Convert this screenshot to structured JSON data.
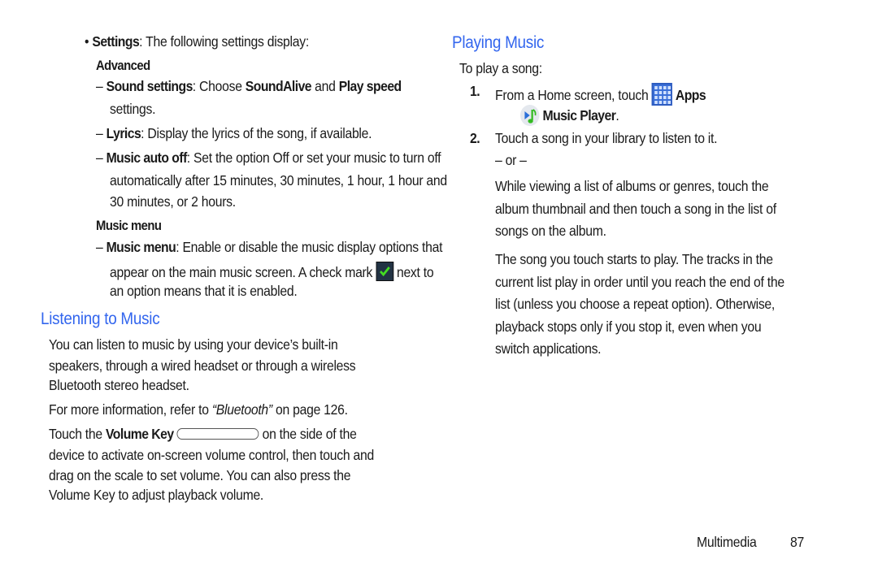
{
  "left": {
    "settings_bullet": {
      "bullet": "•",
      "label": "Settings",
      "text": ": The following settings display:"
    },
    "advanced_heading": "Advanced",
    "sound_settings": {
      "dash": "–",
      "label": "Sound settings",
      "text1": ": Choose ",
      "bold1": "SoundAlive",
      "text2": " and ",
      "bold2": "Play speed",
      "line2": "settings."
    },
    "lyrics": {
      "dash": "–",
      "label": "Lyrics",
      "text": ": Display the lyrics of the song, if available."
    },
    "music_auto_off": {
      "dash": "–",
      "label": "Music auto off",
      "text": ": Set the option Off or set your music to turn off",
      "line2": "automatically after 15 minutes, 30 minutes, 1 hour, 1 hour and",
      "line3": "30 minutes, or 2 hours."
    },
    "music_menu_heading": "Music menu",
    "music_menu": {
      "dash": "–",
      "label": "Music menu",
      "text": ": Enable or disable the music display options that",
      "line2a": "appear on the main music screen. A check mark",
      "line2b": "next to",
      "line3": "an option means that it is enabled."
    },
    "listening_heading": "Listening to Music",
    "listening_para": [
      "You can listen to music by using your device’s built-in",
      "speakers, through a wired headset or through a wireless",
      "Bluetooth stereo headset."
    ],
    "more_info": {
      "text1": "For more information, refer to ",
      "link": "“Bluetooth”",
      "text2": " on page 126."
    },
    "volume_para": {
      "text1": "Touch the ",
      "bold": "Volume Key",
      "text2": " on the side of the",
      "lines": [
        "device to activate on-screen volume control, then touch and",
        "drag on the scale to set volume. You can also press the",
        "Volume Key to adjust playback volume."
      ]
    }
  },
  "right": {
    "playing_heading": "Playing Music",
    "intro": "To play a song:",
    "step1": {
      "num": "1.",
      "text": "From a Home screen, touch ",
      "apps_label": "Apps",
      "arrow": "➔",
      "music_player_label": "Music Player",
      "period": "."
    },
    "step2": {
      "num": "2.",
      "text": "Touch a song in your library to listen to it.",
      "or": "– or –",
      "alt": [
        "While viewing a list of albums or genres, touch the",
        "album thumbnail and then touch a song in the list of",
        "songs on the album."
      ]
    },
    "para": [
      "The song you touch starts to play. The tracks in the",
      "current list play in order until you reach the end of the",
      "list (unless you choose a repeat option). Otherwise,",
      "playback stops only if you stop it, even when you",
      "switch applications."
    ]
  },
  "footer": {
    "section": "Multimedia",
    "page": "87"
  },
  "colors": {
    "heading": "#3366ee",
    "text": "#1a1a1a"
  }
}
